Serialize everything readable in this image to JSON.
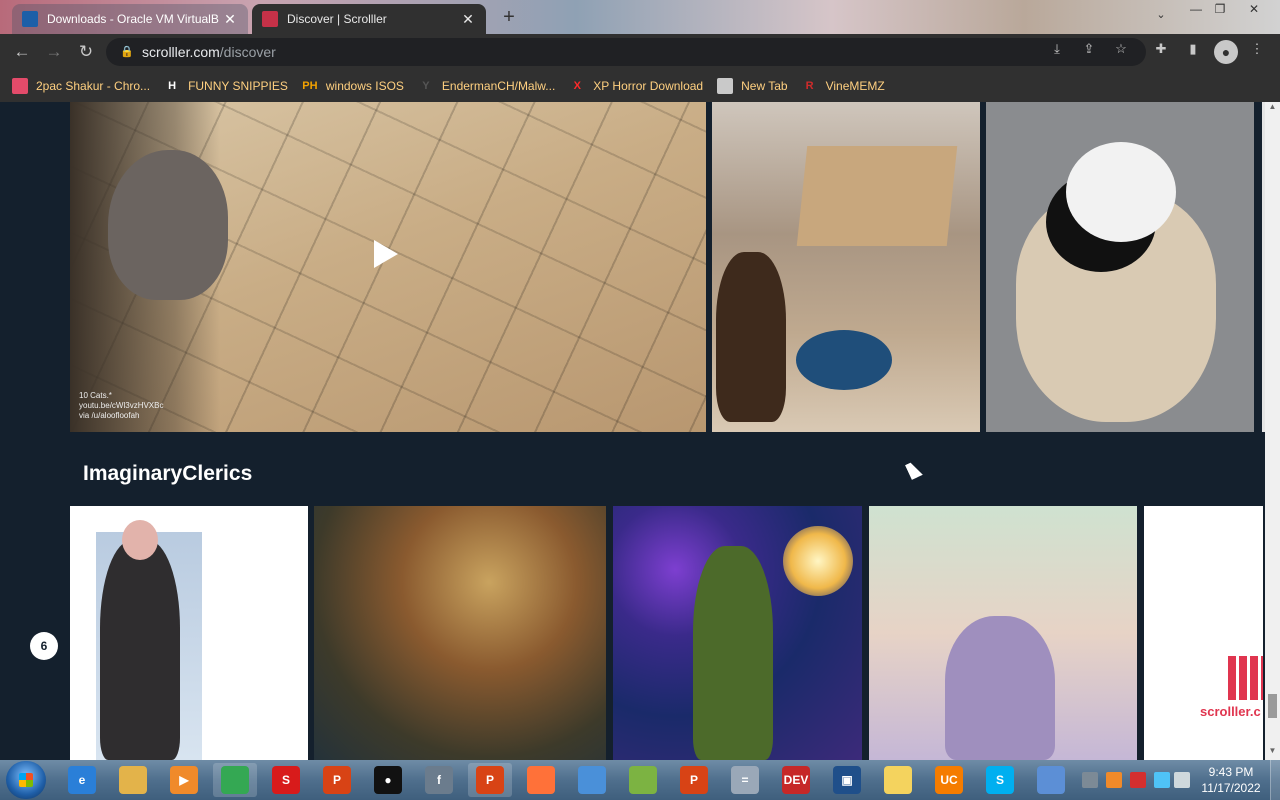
{
  "browser": {
    "tabs": [
      {
        "title": "Downloads - Oracle VM VirtualB",
        "close": "✕",
        "active": false
      },
      {
        "title": "Discover | Scrolller",
        "close": "✕",
        "active": true
      }
    ],
    "new_tab": "+",
    "url_host": "scrolller.com",
    "url_path": "/discover",
    "bookmarks": [
      {
        "label": "2pac Shakur - Chro...",
        "icon": "bookmark-site-icon",
        "icon_text": "",
        "color": "#e34b6a"
      },
      {
        "label": "FUNNY SNIPPIES",
        "icon": "bookmark-h-icon",
        "icon_text": "H",
        "color": "#ffffff"
      },
      {
        "label": "windows ISOS",
        "icon": "bookmark-ph-icon",
        "icon_text": "PH",
        "color": "#f0a000"
      },
      {
        "label": "EndermanCH/Malw...",
        "icon": "bookmark-y-icon",
        "icon_text": "Y",
        "color": "#555555"
      },
      {
        "label": "XP Horror Download",
        "icon": "bookmark-x-icon",
        "icon_text": "X",
        "color": "#ff2a2a"
      },
      {
        "label": "New Tab",
        "icon": "bookmark-globe-icon",
        "icon_text": "",
        "color": "#c9c9c9"
      },
      {
        "label": "VineMEMZ",
        "icon": "bookmark-r-icon",
        "icon_text": "R",
        "color": "#d02b2b"
      }
    ]
  },
  "page": {
    "video_caption": [
      "10 Cats.*",
      "youtu.be/cWl3vzHVXBc",
      "via /u/aloofloofah"
    ],
    "section_title": "ImaginaryClerics",
    "logo_text": "scrolller.c",
    "timer_icon_text": "6"
  },
  "taskbar": {
    "time": "9:43 PM",
    "date": "11/17/2022",
    "apps": [
      {
        "name": "ie",
        "color": "#2a7fd8",
        "glyph": "e"
      },
      {
        "name": "explorer",
        "color": "#e3b34a",
        "glyph": ""
      },
      {
        "name": "media-player",
        "color": "#f08a2a",
        "glyph": "▶"
      },
      {
        "name": "chrome",
        "color": "#34a853",
        "glyph": "",
        "running": true
      },
      {
        "name": "scratch",
        "color": "#d81b1b",
        "glyph": "S"
      },
      {
        "name": "paint",
        "color": "#d84315",
        "glyph": "P"
      },
      {
        "name": "recorder",
        "color": "#111111",
        "glyph": "●"
      },
      {
        "name": "flash",
        "color": "#6b7c8d",
        "glyph": "f"
      },
      {
        "name": "paint-running",
        "color": "#d84315",
        "glyph": "P",
        "running": true
      },
      {
        "name": "firefox",
        "color": "#ff7139",
        "glyph": ""
      },
      {
        "name": "computer",
        "color": "#4a90d9",
        "glyph": ""
      },
      {
        "name": "pea",
        "color": "#7cb342",
        "glyph": ""
      },
      {
        "name": "paint-2",
        "color": "#d84315",
        "glyph": "P"
      },
      {
        "name": "calculator",
        "color": "#9aa8b8",
        "glyph": "="
      },
      {
        "name": "devcpp",
        "color": "#c62828",
        "glyph": "DEV"
      },
      {
        "name": "virtualbox",
        "color": "#1f4f8a",
        "glyph": "▣"
      },
      {
        "name": "notes",
        "color": "#f4d35e",
        "glyph": ""
      },
      {
        "name": "uc-browser",
        "color": "#f57c00",
        "glyph": "UC"
      },
      {
        "name": "skype",
        "color": "#00aff0",
        "glyph": "S"
      },
      {
        "name": "remote",
        "color": "#5c8fd6",
        "glyph": ""
      }
    ]
  }
}
